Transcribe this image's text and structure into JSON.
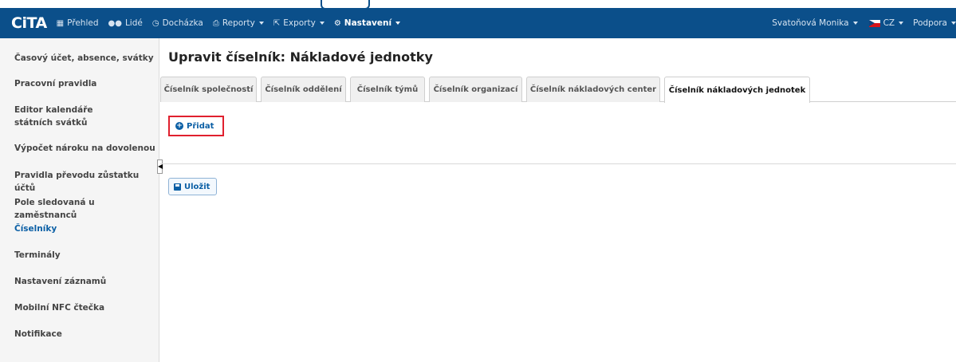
{
  "app": {
    "logo_text": "CiTA"
  },
  "nav": {
    "items": [
      {
        "label": "Přehled",
        "icon": "grid-icon",
        "dropdown": false,
        "active": false
      },
      {
        "label": "Lidé",
        "icon": "people-icon",
        "dropdown": false,
        "active": false
      },
      {
        "label": "Docházka",
        "icon": "clock-icon",
        "dropdown": false,
        "active": false
      },
      {
        "label": "Reporty",
        "icon": "printer-icon",
        "dropdown": true,
        "active": false
      },
      {
        "label": "Exporty",
        "icon": "export-icon",
        "dropdown": true,
        "active": false
      },
      {
        "label": "Nastavení",
        "icon": "gear-icon",
        "dropdown": true,
        "active": true
      }
    ],
    "user": "Svatoňová Monika",
    "language": "CZ",
    "support": "Podpora"
  },
  "sidebar": {
    "items": [
      {
        "label": "Časový účet, absence, svátky",
        "active": false
      },
      {
        "label": "Pracovní pravidla",
        "active": false
      },
      {
        "label": "Editor kalendáře státních svátků",
        "active": false
      },
      {
        "label": "Výpočet nároku na dovolenou",
        "active": false
      },
      {
        "label": "Pravidla převodu zůstatku účtů",
        "active": false
      },
      {
        "label": "Pole sledovaná u zaměstnanců",
        "active": false
      },
      {
        "label": "Číselníky",
        "active": true
      },
      {
        "label": "Terminály",
        "active": false
      },
      {
        "label": "Nastavení záznamů",
        "active": false
      },
      {
        "label": "Mobilní NFC čtečka",
        "active": false
      },
      {
        "label": "Notifikace",
        "active": false
      }
    ]
  },
  "main": {
    "title": "Upravit číselník: Nákladové jednotky",
    "tabs": [
      {
        "label": "Číselník společností",
        "active": false
      },
      {
        "label": "Číselník oddělení",
        "active": false
      },
      {
        "label": "Číselník týmů",
        "active": false
      },
      {
        "label": "Číselník organizací",
        "active": false
      },
      {
        "label": "Číselník nákladových center",
        "active": false
      },
      {
        "label": "Číselník nákladových jednotek",
        "active": true
      }
    ],
    "add_button": "Přidat",
    "save_button": "Uložit"
  },
  "colors": {
    "nav_bg": "#0b4f8a",
    "accent": "#0b5fa5",
    "highlight_border": "#e0202e"
  }
}
